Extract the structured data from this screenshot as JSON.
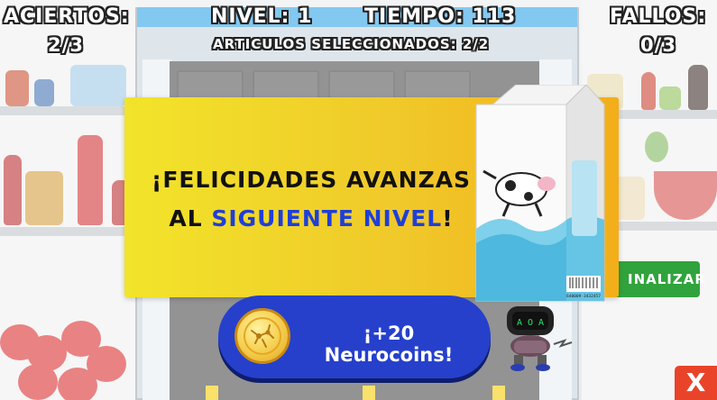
{
  "hud": {
    "hits_label": "ACIERTOS:",
    "hits_value": "2/3",
    "level_label": "NIVEL: 1",
    "time_label": "TIEMPO: 113",
    "selected_label": "ARTICULOS SELECCIONADOS: 2/2",
    "fails_label": "FALLOS:",
    "fails_value": "0/3"
  },
  "modal": {
    "line1": "¡FELICIDADES AVANZAS",
    "line2_prefix": "AL ",
    "line2_highlight": "SIGUIENTE NIVEL",
    "line2_suffix": "!",
    "reward_label": "¡+20 Neurocoins!",
    "milk_barcode": "640009-3432457"
  },
  "finalize_label": "INALIZAR",
  "close_label": "X",
  "colors": {
    "banner_yellow": "#f2e42a",
    "banner_orange": "#f3ae19",
    "reward_blue": "#2640cc",
    "highlight_blue": "#1f3fd8",
    "finalize_green": "#31a33c",
    "close_red": "#e9432a",
    "fridge_top_blue": "#2aa1e6"
  },
  "icons": {
    "coin": "neurocoin-icon",
    "robot": "robot-mascot-icon",
    "milk": "milk-carton-icon",
    "close": "close-icon"
  }
}
